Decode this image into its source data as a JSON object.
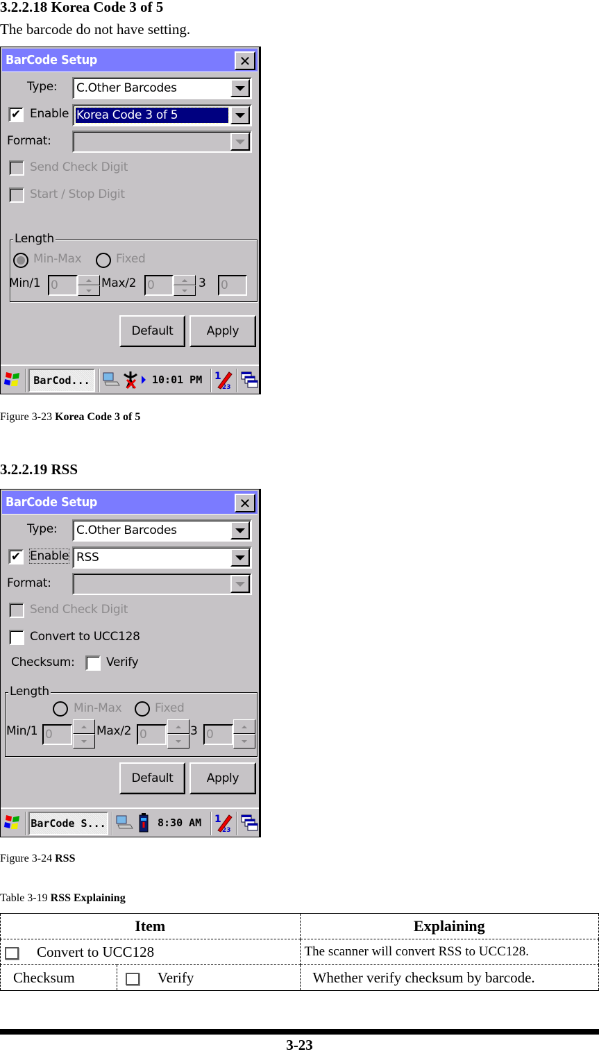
{
  "section1": {
    "heading": "3.2.2.18 Korea Code 3 of 5",
    "description": "The barcode do not have setting.",
    "screenshot": {
      "window_title": "BarCode Setup",
      "type_label": "Type:",
      "type_value": "C.Other Barcodes",
      "enable_label": "Enable",
      "enable_checked": "✔",
      "barcode_value": "Korea Code 3 of 5",
      "format_label": "Format:",
      "send_check_digit": "Send Check Digit",
      "start_stop_digit": "Start / Stop Digit",
      "length_legend": "Length",
      "radio_minmax": "Min-Max",
      "radio_fixed": "Fixed",
      "min_label": "Min/1",
      "min_value": "0",
      "max_label": "Max/2",
      "max_value": "0",
      "third_label": "3",
      "third_value": "0",
      "default_button": "Default",
      "apply_button": "Apply",
      "taskbar_app": "BarCod...",
      "clock": "10:01 PM"
    },
    "caption_prefix": "Figure 3-23 ",
    "caption_bold": "Korea Code 3 of 5"
  },
  "section2": {
    "heading": "3.2.2.19 RSS",
    "screenshot": {
      "window_title": "BarCode Setup",
      "type_label": "Type:",
      "type_value": "C.Other Barcodes",
      "enable_label": "Enable",
      "enable_checked": "✔",
      "barcode_value": "RSS",
      "format_label": "Format:",
      "send_check_digit": "Send Check Digit",
      "convert_label": "Convert to UCC128",
      "checksum_label": "Checksum:",
      "verify_label": "Verify",
      "length_legend": "Length",
      "radio_minmax": "Min-Max",
      "radio_fixed": "Fixed",
      "min_label": "Min/1",
      "min_value": "0",
      "max_label": "Max/2",
      "max_value": "0",
      "third_label": "3",
      "third_value": "0",
      "default_button": "Default",
      "apply_button": "Apply",
      "taskbar_app": "BarCode S...",
      "clock": "8:30 AM"
    },
    "caption_prefix": "Figure 3-24 ",
    "caption_bold": "RSS"
  },
  "table": {
    "caption_prefix": "Table 3-19 ",
    "caption_bold": "RSS Explaining",
    "headers": [
      "Item",
      "Explaining"
    ],
    "rows": [
      {
        "item": "Convert to UCC128",
        "explaining": "The scanner will convert RSS to UCC128."
      },
      {
        "group": "Checksum",
        "item": "Verify",
        "explaining": "Whether verify checksum by barcode."
      }
    ]
  },
  "footer": {
    "page_number": "3-23"
  },
  "colors": {
    "titlebar": "#7b7bff",
    "dialog_bg": "#c6c3c6",
    "selection": "#000080"
  }
}
